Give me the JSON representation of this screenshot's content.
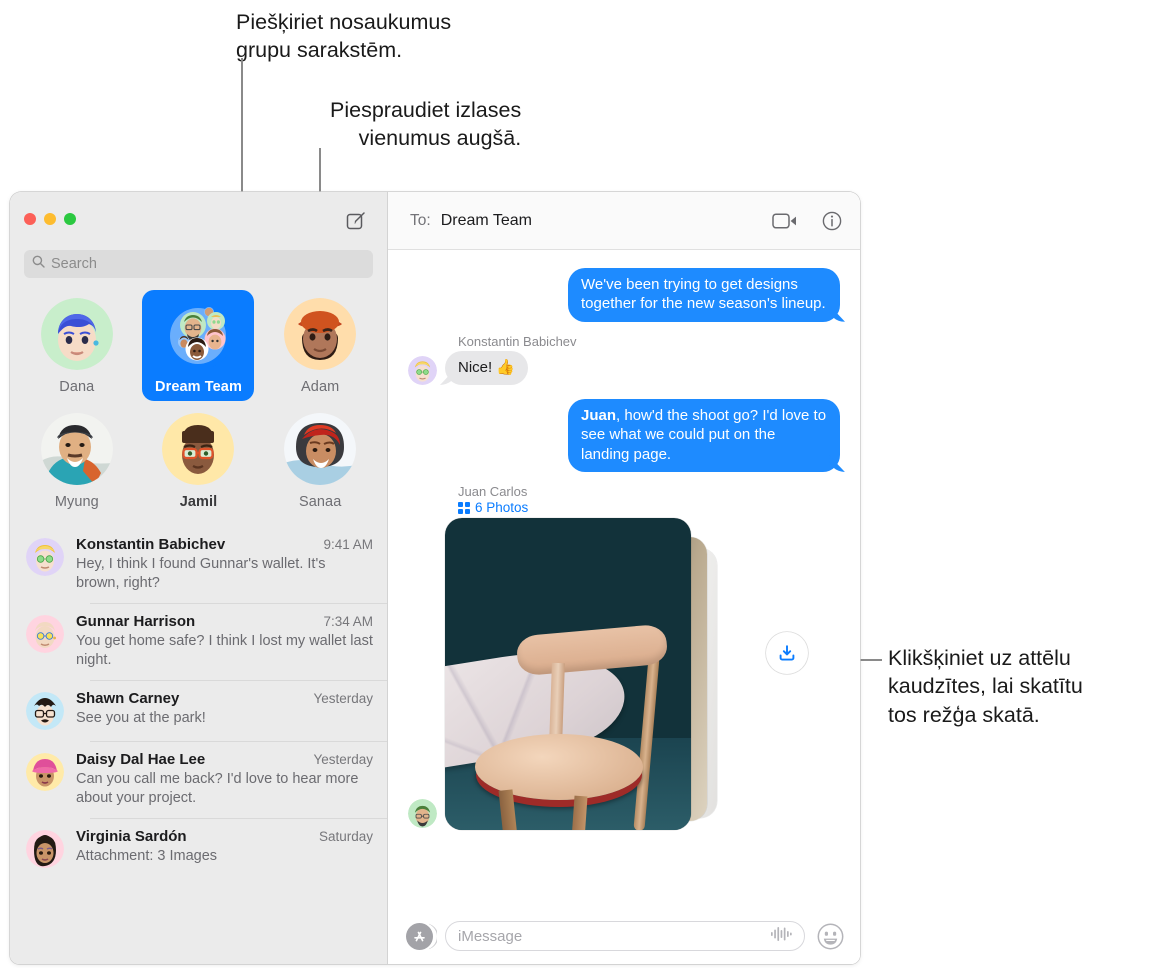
{
  "callouts": [
    {
      "id": "name-group-conversations",
      "text": "Piešķiriet nosaukumus\ngrupu sarakstēm."
    },
    {
      "id": "pin-favorites",
      "text": "Piespraudiet izlases\nvienumus augšā."
    },
    {
      "id": "click-photo-stack",
      "text": "Klikšķiniet uz attēlu\nkaudzītes, lai skatītu\ntos režģa skatā."
    }
  ],
  "window": {
    "traffic_lights": {
      "close": "close-button",
      "minimize": "minimize-button",
      "maximize": "maximize-button",
      "colors": {
        "close": "#fc6058",
        "minimize": "#fdbc2f",
        "maximize": "#2bc840"
      }
    }
  },
  "sidebar": {
    "compose_icon": "compose-icon",
    "search": {
      "placeholder": "Search",
      "value": "",
      "icon": "search-icon"
    },
    "pinned": [
      {
        "name": "Dana",
        "selected": false,
        "unread": false,
        "avatar": "memoji-blue-hair"
      },
      {
        "name": "Dream Team",
        "selected": true,
        "unread": false,
        "avatar": "group-memoji-stack"
      },
      {
        "name": "Adam",
        "selected": false,
        "unread": false,
        "avatar": "memoji-orange-hat"
      },
      {
        "name": "Myung",
        "selected": false,
        "unread": false,
        "avatar": "photo-man-cap"
      },
      {
        "name": "Jamil",
        "selected": false,
        "unread": true,
        "avatar": "memoji-red-glasses"
      },
      {
        "name": "Sanaa",
        "selected": false,
        "unread": false,
        "avatar": "photo-woman-red-hair"
      }
    ],
    "conversations": [
      {
        "name": "Konstantin Babichev",
        "time": "9:41 AM",
        "preview": "Hey, I think I found Gunnar's wallet. It's brown, right?",
        "avatar": "memoji-blond-green-glasses"
      },
      {
        "name": "Gunnar Harrison",
        "time": "7:34 AM",
        "preview": "You get home safe? I think I lost my wallet last night.",
        "avatar": "memoji-bald-yellow-glasses"
      },
      {
        "name": "Shawn Carney",
        "time": "Yesterday",
        "preview": "See you at the park!",
        "avatar": "memoji-mustache-glasses"
      },
      {
        "name": "Daisy Dal Hae Lee",
        "time": "Yesterday",
        "preview": "Can you call me back? I'd love to hear more about your project.",
        "avatar": "memoji-pink-cap"
      },
      {
        "name": "Virginia Sardón",
        "time": "Saturday",
        "preview": "Attachment: 3 Images",
        "avatar": "memoji-dark-hair"
      }
    ]
  },
  "conversation": {
    "to_label": "To:",
    "to_value": "Dream Team",
    "video_icon": "facetime-video-icon",
    "info_icon": "info-icon",
    "messages": [
      {
        "type": "text",
        "direction": "out",
        "text": "We've been trying to get designs together for the new season's lineup."
      },
      {
        "type": "text",
        "direction": "in",
        "sender": "Konstantin Babichev",
        "text": "Nice!  👍",
        "avatar": "memoji-blond-green-glasses"
      },
      {
        "type": "text",
        "direction": "out",
        "text_bold": "Juan",
        "text": ", how'd the shoot go? I'd love to see what we could put on the landing page."
      },
      {
        "type": "photo-stack",
        "direction": "in",
        "sender": "Juan Carlos",
        "count_label": "6 Photos",
        "grid_icon": "photo-grid-icon",
        "avatar": "memoji-green-hair-glasses",
        "download_icon": "download-icon"
      }
    ]
  },
  "input_bar": {
    "app_icon": "app-store-icon",
    "placeholder": "iMessage",
    "value": "",
    "audio_icon": "audio-waveform-icon",
    "emoji_icon": "emoji-smiley-icon"
  },
  "colors": {
    "accent_blue": "#0a7cff",
    "bubble_out": "#1e8bff",
    "bubble_in": "#e7e7e9",
    "sidebar_bg": "#ebebeb"
  }
}
